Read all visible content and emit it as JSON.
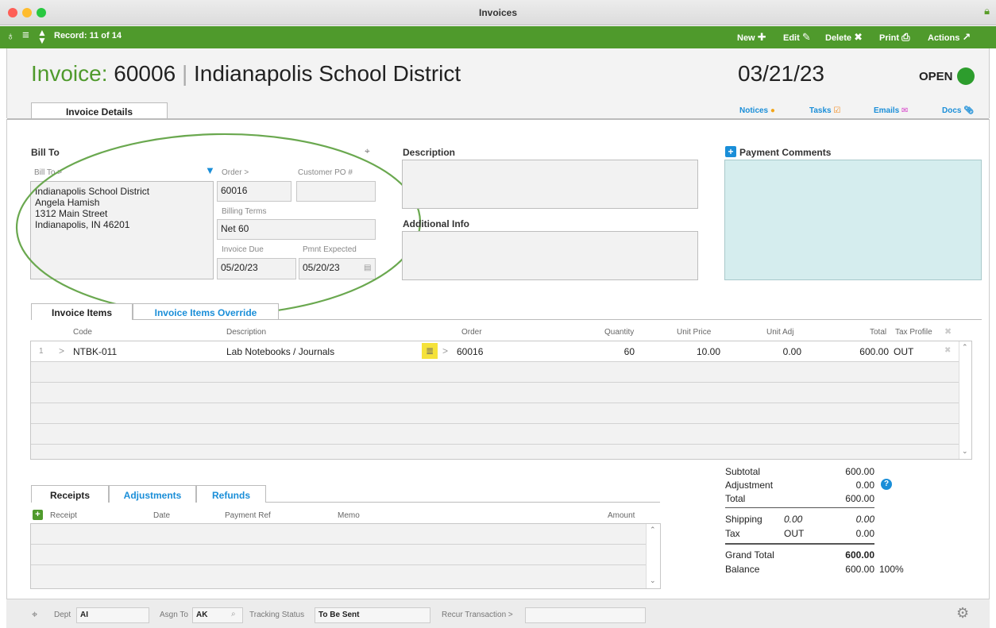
{
  "window": {
    "title": "Invoices"
  },
  "toolbar": {
    "record": "Record: 11 of 14",
    "new": "New",
    "edit": "Edit",
    "delete": "Delete",
    "print": "Print",
    "actions": "Actions"
  },
  "header": {
    "invoice_label": "Invoice:",
    "invoice_number": "60006",
    "separator": "|",
    "customer": "Indianapolis School District",
    "date": "03/21/23",
    "status": "OPEN",
    "status_color": "#2d9d2d",
    "accent": "#4f9a2c"
  },
  "tabs": {
    "details": "Invoice Details",
    "notices": "Notices",
    "tasks": "Tasks",
    "emails": "Emails",
    "docs": "Docs"
  },
  "bill_to": {
    "section": "Bill To",
    "field_label": "Bill To >",
    "lines": [
      "Indianapolis School District",
      "Angela Hamish",
      "1312 Main Street",
      "Indianapolis, IN 46201"
    ],
    "order_label": "Order >",
    "order_value": "60016",
    "customer_po_label": "Customer PO #",
    "customer_po_value": "",
    "billing_terms_label": "Billing Terms",
    "billing_terms_value": "Net 60",
    "invoice_due_label": "Invoice Due",
    "invoice_due_value": "05/20/23",
    "pmnt_expected_label": "Pmnt Expected",
    "pmnt_expected_value": "05/20/23"
  },
  "description": {
    "label": "Description",
    "value": ""
  },
  "additional_info": {
    "label": "Additional Info",
    "value": ""
  },
  "payment_comments": {
    "label": "Payment Comments",
    "value": ""
  },
  "items_tabs": {
    "items": "Invoice Items",
    "override": "Invoice Items Override"
  },
  "items": {
    "columns": [
      "Code",
      "Description",
      "Order",
      "Quantity",
      "Unit Price",
      "Unit Adj",
      "Total",
      "Tax Profile"
    ],
    "rows": [
      {
        "num": "1",
        "code": "NTBK-011",
        "description": "Lab Notebooks / Journals",
        "order": "60016",
        "quantity": "60",
        "unit_price": "10.00",
        "unit_adj": "0.00",
        "total": "600.00",
        "tax_profile": "OUT"
      }
    ]
  },
  "receipts_tabs": {
    "receipts": "Receipts",
    "adjustments": "Adjustments",
    "refunds": "Refunds"
  },
  "receipts": {
    "columns": [
      "Receipt",
      "Date",
      "Payment Ref",
      "Memo",
      "Amount"
    ]
  },
  "summary": {
    "subtotal_label": "Subtotal",
    "subtotal": "600.00",
    "adjustment_label": "Adjustment",
    "adjustment": "0.00",
    "total_label": "Total",
    "total": "600.00",
    "shipping_label": "Shipping",
    "shipping_mid": "0.00",
    "shipping": "0.00",
    "tax_label": "Tax",
    "tax_mid": "OUT",
    "tax": "0.00",
    "grand_total_label": "Grand Total",
    "grand_total": "600.00",
    "balance_label": "Balance",
    "balance": "600.00",
    "balance_pct": "100%"
  },
  "footer": {
    "dept_label": "Dept",
    "dept_value": "AI",
    "asgn_label": "Asgn To",
    "asgn_value": "AK",
    "tracking_label": "Tracking Status",
    "tracking_value": "To Be Sent",
    "recur_label": "Recur Transaction >",
    "recur_value": ""
  }
}
